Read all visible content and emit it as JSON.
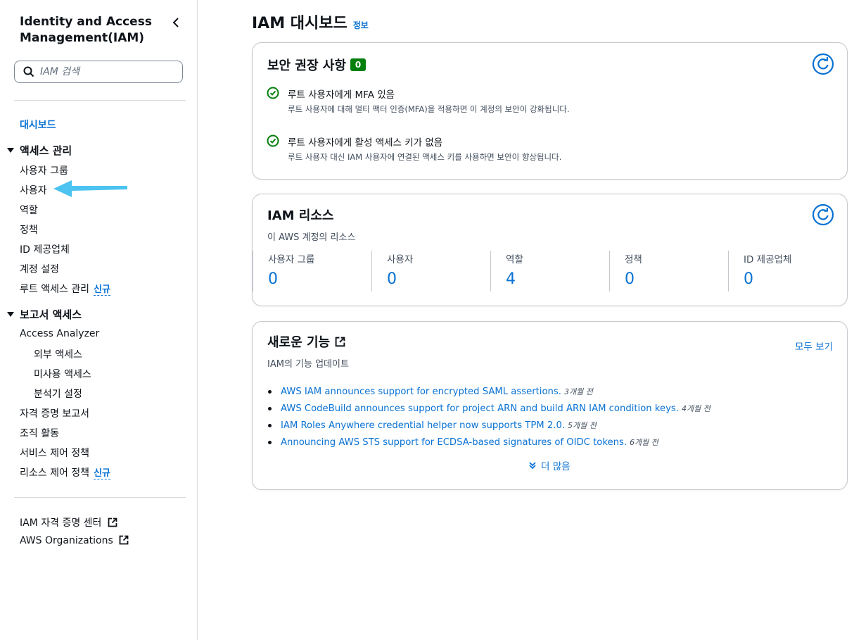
{
  "sidebar": {
    "title": "Identity and Access Management(IAM)",
    "search_placeholder": "IAM 검색",
    "dashboard": "대시보드",
    "access_mgmt": {
      "label": "액세스 관리",
      "items": [
        "사용자 그룹",
        "사용자",
        "역할",
        "정책",
        "ID 제공업체",
        "계정 설정",
        "루트 액세스 관리"
      ],
      "new_badge": "신규"
    },
    "report_access": {
      "label": "보고서 액세스",
      "analyzer": "Access Analyzer",
      "analyzer_items": [
        "외부 액세스",
        "미사용 액세스",
        "분석기 설정"
      ],
      "items": [
        "자격 증명 보고서",
        "조직 활동",
        "서비스 제어 정책",
        "리소스 제어 정책"
      ],
      "new_badge": "신규"
    },
    "external_links": [
      "IAM 자격 증명 센터",
      "AWS Organizations"
    ],
    "annotation_arrow_color": "#4cc3f0"
  },
  "header": {
    "title": "IAM 대시보드",
    "info": "정보"
  },
  "security": {
    "title": "보안 권장 사항",
    "count": "0",
    "items": [
      {
        "title": "루트 사용자에게 MFA 있음",
        "desc": "루트 사용자에 대해 멀티 팩터 인증(MFA)을 적용하면 이 계정의 보안이 강화됩니다."
      },
      {
        "title": "루트 사용자에게 활성 액세스 키가 없음",
        "desc": "루트 사용자 대신 IAM 사용자에 연결된 액세스 키를 사용하면 보안이 향상됩니다."
      }
    ]
  },
  "resources": {
    "title": "IAM 리소스",
    "subtitle": "이 AWS 계정의 리소스",
    "items": [
      {
        "label": "사용자 그룹",
        "value": "0"
      },
      {
        "label": "사용자",
        "value": "0"
      },
      {
        "label": "역할",
        "value": "4"
      },
      {
        "label": "정책",
        "value": "0"
      },
      {
        "label": "ID 제공업체",
        "value": "0"
      }
    ]
  },
  "features": {
    "title": "새로운 기능",
    "subtitle": "IAM의 기능 업데이트",
    "view_all": "모두 보기",
    "items": [
      {
        "text": "AWS IAM announces support for encrypted SAML assertions.",
        "time": "3개월 전"
      },
      {
        "text": "AWS CodeBuild announces support for project ARN and build ARN IAM condition keys.",
        "time": "4개월 전"
      },
      {
        "text": "IAM Roles Anywhere credential helper now supports TPM 2.0.",
        "time": "5개월 전"
      },
      {
        "text": "Announcing AWS STS support for ECDSA-based signatures of OIDC tokens.",
        "time": "6개월 전"
      }
    ],
    "more": "더 많음"
  },
  "colors": {
    "link": "#0972d3",
    "success": "#037f0c",
    "text": "#0f141a"
  }
}
